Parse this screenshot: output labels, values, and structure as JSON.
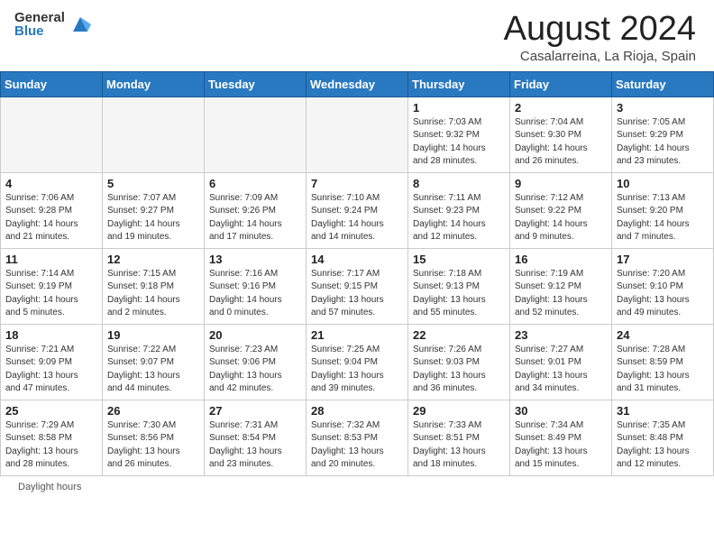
{
  "header": {
    "logo_general": "General",
    "logo_blue": "Blue",
    "month_title": "August 2024",
    "location": "Casalarreina, La Rioja, Spain"
  },
  "footer": {
    "daylight_label": "Daylight hours"
  },
  "weekdays": [
    "Sunday",
    "Monday",
    "Tuesday",
    "Wednesday",
    "Thursday",
    "Friday",
    "Saturday"
  ],
  "weeks": [
    [
      {
        "day": "",
        "info": ""
      },
      {
        "day": "",
        "info": ""
      },
      {
        "day": "",
        "info": ""
      },
      {
        "day": "",
        "info": ""
      },
      {
        "day": "1",
        "info": "Sunrise: 7:03 AM\nSunset: 9:32 PM\nDaylight: 14 hours\nand 28 minutes."
      },
      {
        "day": "2",
        "info": "Sunrise: 7:04 AM\nSunset: 9:30 PM\nDaylight: 14 hours\nand 26 minutes."
      },
      {
        "day": "3",
        "info": "Sunrise: 7:05 AM\nSunset: 9:29 PM\nDaylight: 14 hours\nand 23 minutes."
      }
    ],
    [
      {
        "day": "4",
        "info": "Sunrise: 7:06 AM\nSunset: 9:28 PM\nDaylight: 14 hours\nand 21 minutes."
      },
      {
        "day": "5",
        "info": "Sunrise: 7:07 AM\nSunset: 9:27 PM\nDaylight: 14 hours\nand 19 minutes."
      },
      {
        "day": "6",
        "info": "Sunrise: 7:09 AM\nSunset: 9:26 PM\nDaylight: 14 hours\nand 17 minutes."
      },
      {
        "day": "7",
        "info": "Sunrise: 7:10 AM\nSunset: 9:24 PM\nDaylight: 14 hours\nand 14 minutes."
      },
      {
        "day": "8",
        "info": "Sunrise: 7:11 AM\nSunset: 9:23 PM\nDaylight: 14 hours\nand 12 minutes."
      },
      {
        "day": "9",
        "info": "Sunrise: 7:12 AM\nSunset: 9:22 PM\nDaylight: 14 hours\nand 9 minutes."
      },
      {
        "day": "10",
        "info": "Sunrise: 7:13 AM\nSunset: 9:20 PM\nDaylight: 14 hours\nand 7 minutes."
      }
    ],
    [
      {
        "day": "11",
        "info": "Sunrise: 7:14 AM\nSunset: 9:19 PM\nDaylight: 14 hours\nand 5 minutes."
      },
      {
        "day": "12",
        "info": "Sunrise: 7:15 AM\nSunset: 9:18 PM\nDaylight: 14 hours\nand 2 minutes."
      },
      {
        "day": "13",
        "info": "Sunrise: 7:16 AM\nSunset: 9:16 PM\nDaylight: 14 hours\nand 0 minutes."
      },
      {
        "day": "14",
        "info": "Sunrise: 7:17 AM\nSunset: 9:15 PM\nDaylight: 13 hours\nand 57 minutes."
      },
      {
        "day": "15",
        "info": "Sunrise: 7:18 AM\nSunset: 9:13 PM\nDaylight: 13 hours\nand 55 minutes."
      },
      {
        "day": "16",
        "info": "Sunrise: 7:19 AM\nSunset: 9:12 PM\nDaylight: 13 hours\nand 52 minutes."
      },
      {
        "day": "17",
        "info": "Sunrise: 7:20 AM\nSunset: 9:10 PM\nDaylight: 13 hours\nand 49 minutes."
      }
    ],
    [
      {
        "day": "18",
        "info": "Sunrise: 7:21 AM\nSunset: 9:09 PM\nDaylight: 13 hours\nand 47 minutes."
      },
      {
        "day": "19",
        "info": "Sunrise: 7:22 AM\nSunset: 9:07 PM\nDaylight: 13 hours\nand 44 minutes."
      },
      {
        "day": "20",
        "info": "Sunrise: 7:23 AM\nSunset: 9:06 PM\nDaylight: 13 hours\nand 42 minutes."
      },
      {
        "day": "21",
        "info": "Sunrise: 7:25 AM\nSunset: 9:04 PM\nDaylight: 13 hours\nand 39 minutes."
      },
      {
        "day": "22",
        "info": "Sunrise: 7:26 AM\nSunset: 9:03 PM\nDaylight: 13 hours\nand 36 minutes."
      },
      {
        "day": "23",
        "info": "Sunrise: 7:27 AM\nSunset: 9:01 PM\nDaylight: 13 hours\nand 34 minutes."
      },
      {
        "day": "24",
        "info": "Sunrise: 7:28 AM\nSunset: 8:59 PM\nDaylight: 13 hours\nand 31 minutes."
      }
    ],
    [
      {
        "day": "25",
        "info": "Sunrise: 7:29 AM\nSunset: 8:58 PM\nDaylight: 13 hours\nand 28 minutes."
      },
      {
        "day": "26",
        "info": "Sunrise: 7:30 AM\nSunset: 8:56 PM\nDaylight: 13 hours\nand 26 minutes."
      },
      {
        "day": "27",
        "info": "Sunrise: 7:31 AM\nSunset: 8:54 PM\nDaylight: 13 hours\nand 23 minutes."
      },
      {
        "day": "28",
        "info": "Sunrise: 7:32 AM\nSunset: 8:53 PM\nDaylight: 13 hours\nand 20 minutes."
      },
      {
        "day": "29",
        "info": "Sunrise: 7:33 AM\nSunset: 8:51 PM\nDaylight: 13 hours\nand 18 minutes."
      },
      {
        "day": "30",
        "info": "Sunrise: 7:34 AM\nSunset: 8:49 PM\nDaylight: 13 hours\nand 15 minutes."
      },
      {
        "day": "31",
        "info": "Sunrise: 7:35 AM\nSunset: 8:48 PM\nDaylight: 13 hours\nand 12 minutes."
      }
    ]
  ]
}
